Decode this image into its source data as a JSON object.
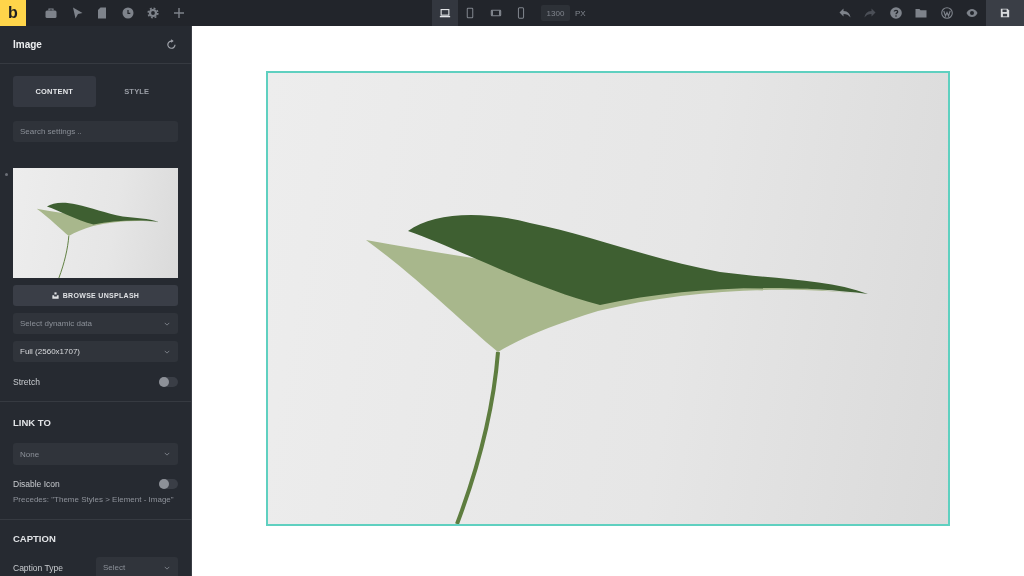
{
  "top_bar": {
    "logo": "b",
    "devices": [
      {
        "selected": true
      },
      {
        "selected": false
      },
      {
        "selected": false
      },
      {
        "selected": false
      }
    ],
    "width": {
      "placeholder": "1300",
      "unit": "PX"
    },
    "undo": {
      "disabled": false
    },
    "redo": {
      "disabled": true
    }
  },
  "panel": {
    "title": "Image",
    "tabs": [
      {
        "label": "CONTENT",
        "selected": true
      },
      {
        "label": "STYLE",
        "selected": false
      }
    ],
    "search": {
      "placeholder": "Search settings .."
    },
    "browse_button": "BROWSE UNSPLASH",
    "dynamic_data": {
      "placeholder": "Select dynamic data"
    },
    "image_size": {
      "value": "Full (2560x1707)"
    },
    "stretch": {
      "label": "Stretch",
      "on": false
    }
  },
  "link_to": {
    "heading": "LINK TO",
    "select": {
      "placeholder": "None"
    },
    "disable_icon": {
      "label": "Disable Icon",
      "on": false
    },
    "hint": "Precedes: \"Theme Styles > Element - Image\""
  },
  "caption": {
    "heading": "CAPTION",
    "caption_type": {
      "label": "Caption Type",
      "placeholder": "Select"
    }
  },
  "canvas": {
    "image": {
      "selected": true
    }
  }
}
